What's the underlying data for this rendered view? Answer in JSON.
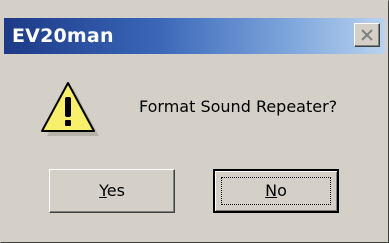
{
  "window": {
    "title": "EV20man"
  },
  "message": {
    "text": "Format Sound Repeater?"
  },
  "buttons": {
    "yes": {
      "accel": "Y",
      "rest": "es"
    },
    "no": {
      "accel": "N",
      "rest": "o"
    }
  },
  "icons": {
    "close": "close-icon",
    "warning": "warning-icon"
  },
  "colors": {
    "face": "#d4d0c8",
    "title_start": "#1c3a86",
    "title_end": "#b9d2ef",
    "warning_fill": "#f8f06a"
  }
}
